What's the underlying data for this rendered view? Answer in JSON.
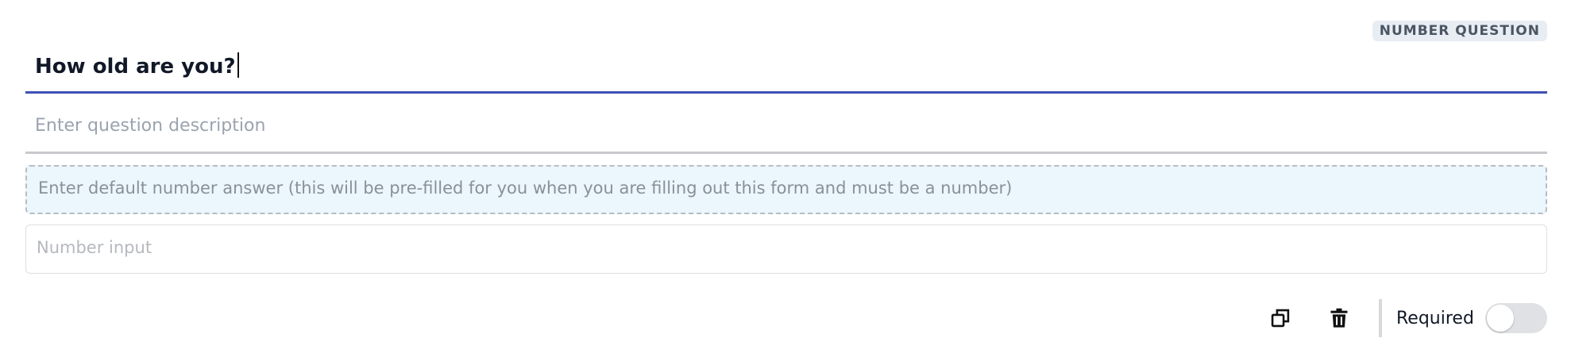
{
  "badge": {
    "label": "NUMBER QUESTION"
  },
  "question": {
    "title_value": "How old are you?",
    "description_placeholder": "Enter question description",
    "default_answer_placeholder": "Enter default number answer (this will be pre-filled for you when you are filling out this form and must be a number)",
    "number_input_placeholder": "Number input"
  },
  "footer": {
    "icons": [
      "duplicate-icon",
      "trash-icon"
    ],
    "required_label": "Required",
    "required_toggle_on": false
  },
  "colors": {
    "accent": "#3f51b5",
    "default_answer_bg": "#ebf6fd",
    "badge_bg": "#e8edf4"
  }
}
